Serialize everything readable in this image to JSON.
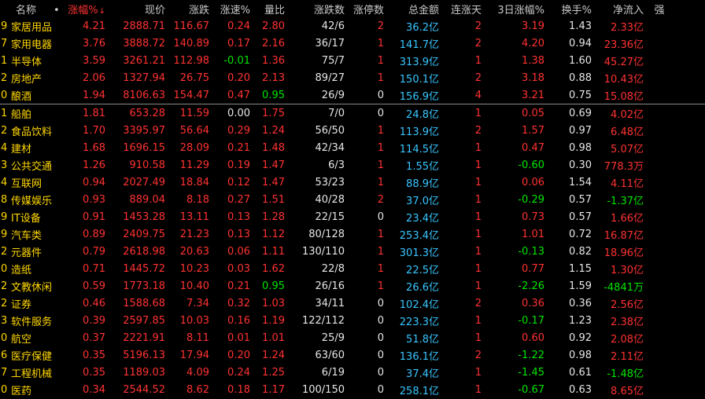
{
  "header": {
    "name": "名称",
    "dot": "•",
    "change_pct": "涨幅%",
    "sort_arrow": "↓",
    "price": "现价",
    "change": "涨跌",
    "speed": "涨速%",
    "vol_ratio": "量比",
    "up_down_count": "涨跌数",
    "limit_up_count": "涨停数",
    "total_amount": "总金额",
    "consecutive_days": "连涨天",
    "change_3d": "3日涨幅%",
    "turnover": "换手%",
    "net_inflow": "净流入",
    "strength": "强"
  },
  "rows_top": [
    {
      "idx": "9",
      "name": "家居用品",
      "change_pct": "4.21",
      "price": "2888.71",
      "change": "116.67",
      "speed": "0.24",
      "vol_ratio": "2.80",
      "updown": "42/6",
      "limit": "2",
      "amount": "36.2亿",
      "days": "2",
      "chg3d": "3.19",
      "turnover": "1.43",
      "inflow": "2.33亿"
    },
    {
      "idx": "7",
      "name": "家用电器",
      "change_pct": "3.76",
      "price": "3888.72",
      "change": "140.89",
      "speed": "0.17",
      "vol_ratio": "2.16",
      "updown": "36/17",
      "limit": "1",
      "amount": "141.7亿",
      "days": "2",
      "chg3d": "4.20",
      "turnover": "0.94",
      "inflow": "23.36亿"
    },
    {
      "idx": "1",
      "name": "半导体",
      "change_pct": "3.59",
      "price": "3261.21",
      "change": "112.98",
      "speed": "-0.01",
      "vol_ratio": "1.36",
      "updown": "75/7",
      "limit": "1",
      "amount": "313.9亿",
      "days": "1",
      "chg3d": "1.38",
      "turnover": "1.60",
      "inflow": "45.27亿"
    },
    {
      "idx": "2",
      "name": "房地产",
      "change_pct": "2.06",
      "price": "1327.94",
      "change": "26.75",
      "speed": "0.20",
      "vol_ratio": "2.13",
      "updown": "89/27",
      "limit": "1",
      "amount": "150.1亿",
      "days": "2",
      "chg3d": "3.18",
      "turnover": "0.88",
      "inflow": "10.43亿"
    },
    {
      "idx": "0",
      "name": "酿酒",
      "change_pct": "1.94",
      "price": "8106.63",
      "change": "154.47",
      "speed": "0.47",
      "vol_ratio": "0.95",
      "updown": "26/9",
      "limit": "0",
      "amount": "156.9亿",
      "days": "4",
      "chg3d": "3.21",
      "turnover": "0.75",
      "inflow": "15.08亿"
    }
  ],
  "rows_bottom": [
    {
      "idx": "1",
      "name": "船舶",
      "change_pct": "1.81",
      "price": "653.28",
      "change": "11.59",
      "speed": "0.00",
      "vol_ratio": "1.75",
      "updown": "7/0",
      "limit": "0",
      "amount": "24.8亿",
      "days": "1",
      "chg3d": "0.05",
      "turnover": "0.69",
      "inflow": "4.02亿"
    },
    {
      "idx": "2",
      "name": "食品饮料",
      "change_pct": "1.70",
      "price": "3395.97",
      "change": "56.64",
      "speed": "0.29",
      "vol_ratio": "1.24",
      "updown": "56/50",
      "limit": "1",
      "amount": "113.9亿",
      "days": "2",
      "chg3d": "1.57",
      "turnover": "0.97",
      "inflow": "6.48亿"
    },
    {
      "idx": "4",
      "name": "建材",
      "change_pct": "1.68",
      "price": "1696.15",
      "change": "28.09",
      "speed": "0.21",
      "vol_ratio": "1.48",
      "updown": "42/34",
      "limit": "1",
      "amount": "114.5亿",
      "days": "1",
      "chg3d": "0.47",
      "turnover": "0.98",
      "inflow": "5.07亿"
    },
    {
      "idx": "3",
      "name": "公共交通",
      "change_pct": "1.26",
      "price": "910.58",
      "change": "11.29",
      "speed": "0.19",
      "vol_ratio": "1.47",
      "updown": "6/3",
      "limit": "1",
      "amount": "1.55亿",
      "days": "1",
      "chg3d": "-0.60",
      "turnover": "0.30",
      "inflow": "778.3万"
    },
    {
      "idx": "4",
      "name": "互联网",
      "change_pct": "0.94",
      "price": "2027.49",
      "change": "18.84",
      "speed": "0.12",
      "vol_ratio": "1.47",
      "updown": "53/23",
      "limit": "1",
      "amount": "88.9亿",
      "days": "1",
      "chg3d": "0.06",
      "turnover": "1.54",
      "inflow": "4.11亿"
    },
    {
      "idx": "8",
      "name": "传媒娱乐",
      "change_pct": "0.93",
      "price": "889.04",
      "change": "8.18",
      "speed": "0.27",
      "vol_ratio": "1.51",
      "updown": "40/28",
      "limit": "2",
      "amount": "37.0亿",
      "days": "1",
      "chg3d": "-0.29",
      "turnover": "0.57",
      "inflow": "-1.37亿"
    },
    {
      "idx": "9",
      "name": "IT设备",
      "change_pct": "0.91",
      "price": "1453.28",
      "change": "13.11",
      "speed": "0.13",
      "vol_ratio": "1.28",
      "updown": "22/15",
      "limit": "0",
      "amount": "23.4亿",
      "days": "1",
      "chg3d": "0.73",
      "turnover": "0.57",
      "inflow": "1.66亿"
    },
    {
      "idx": "9",
      "name": "汽车类",
      "change_pct": "0.89",
      "price": "2409.75",
      "change": "21.23",
      "speed": "0.13",
      "vol_ratio": "1.12",
      "updown": "80/128",
      "limit": "1",
      "amount": "253.4亿",
      "days": "1",
      "chg3d": "1.01",
      "turnover": "0.72",
      "inflow": "16.87亿"
    },
    {
      "idx": "2",
      "name": "元器件",
      "change_pct": "0.79",
      "price": "2618.98",
      "change": "20.63",
      "speed": "0.06",
      "vol_ratio": "1.11",
      "updown": "130/110",
      "limit": "1",
      "amount": "301.3亿",
      "days": "1",
      "chg3d": "-0.13",
      "turnover": "0.82",
      "inflow": "18.96亿"
    },
    {
      "idx": "0",
      "name": "造纸",
      "change_pct": "0.71",
      "price": "1445.72",
      "change": "10.23",
      "speed": "0.03",
      "vol_ratio": "1.62",
      "updown": "22/8",
      "limit": "1",
      "amount": "22.5亿",
      "days": "1",
      "chg3d": "0.77",
      "turnover": "1.15",
      "inflow": "1.30亿"
    },
    {
      "idx": "2",
      "name": "文教休闲",
      "change_pct": "0.59",
      "price": "1773.18",
      "change": "10.40",
      "speed": "0.21",
      "vol_ratio": "0.95",
      "updown": "26/16",
      "limit": "1",
      "amount": "26.6亿",
      "days": "1",
      "chg3d": "-2.26",
      "turnover": "1.59",
      "inflow": "-4841万"
    },
    {
      "idx": "2",
      "name": "证券",
      "change_pct": "0.46",
      "price": "1588.68",
      "change": "7.34",
      "speed": "0.32",
      "vol_ratio": "1.03",
      "updown": "34/11",
      "limit": "0",
      "amount": "102.4亿",
      "days": "2",
      "chg3d": "0.36",
      "turnover": "0.36",
      "inflow": "2.56亿"
    },
    {
      "idx": "3",
      "name": "软件服务",
      "change_pct": "0.39",
      "price": "2597.85",
      "change": "10.03",
      "speed": "0.16",
      "vol_ratio": "1.19",
      "updown": "122/112",
      "limit": "0",
      "amount": "223.3亿",
      "days": "1",
      "chg3d": "-0.17",
      "turnover": "1.23",
      "inflow": "2.38亿"
    },
    {
      "idx": "0",
      "name": "航空",
      "change_pct": "0.37",
      "price": "2221.91",
      "change": "8.11",
      "speed": "0.01",
      "vol_ratio": "1.01",
      "updown": "25/9",
      "limit": "0",
      "amount": "51.8亿",
      "days": "1",
      "chg3d": "0.60",
      "turnover": "0.92",
      "inflow": "2.08亿"
    },
    {
      "idx": "6",
      "name": "医疗保健",
      "change_pct": "0.35",
      "price": "5196.13",
      "change": "17.94",
      "speed": "0.20",
      "vol_ratio": "1.24",
      "updown": "63/60",
      "limit": "0",
      "amount": "136.1亿",
      "days": "2",
      "chg3d": "-1.22",
      "turnover": "0.98",
      "inflow": "2.11亿"
    },
    {
      "idx": "7",
      "name": "工程机械",
      "change_pct": "0.35",
      "price": "1189.03",
      "change": "4.09",
      "speed": "0.24",
      "vol_ratio": "1.25",
      "updown": "6/19",
      "limit": "0",
      "amount": "37.4亿",
      "days": "1",
      "chg3d": "-1.45",
      "turnover": "0.61",
      "inflow": "-1.48亿"
    },
    {
      "idx": "0",
      "name": "医药",
      "change_pct": "0.34",
      "price": "2544.52",
      "change": "8.62",
      "speed": "0.18",
      "vol_ratio": "1.17",
      "updown": "100/150",
      "limit": "0",
      "amount": "258.1亿",
      "days": "1",
      "chg3d": "-0.67",
      "turnover": "0.63",
      "inflow": "8.65亿"
    }
  ],
  "colors": {
    "up": "#ff3232",
    "down": "#00e600",
    "flat": "#e6e6e6",
    "amount": "#39c6ff",
    "name": "#ffd700",
    "background": "#000000"
  }
}
